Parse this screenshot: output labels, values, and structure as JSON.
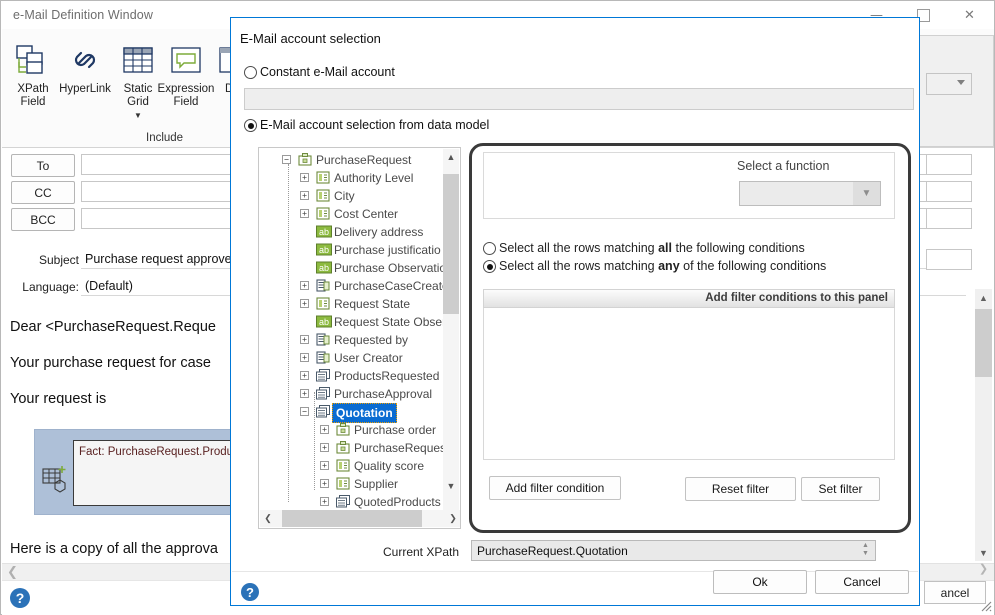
{
  "background_window": {
    "title": "e-Mail Definition Window",
    "window_buttons": {
      "minimize": "—",
      "maximize": "▢",
      "close": "✕"
    },
    "ribbon": {
      "group_label": "Include",
      "items": [
        {
          "label_line1": "XPath",
          "label_line2": "Field",
          "icon": "xpath-field-icon"
        },
        {
          "label_line1": "HyperLink",
          "label_line2": "",
          "icon": "hyperlink-icon"
        },
        {
          "label_line1": "Static",
          "label_line2": "Grid",
          "icon": "static-grid-icon"
        },
        {
          "label_line1": "Expression",
          "label_line2": "Field",
          "icon": "expression-field-icon"
        },
        {
          "label_line1": "Dy",
          "label_line2": "",
          "icon": "dynamic-field-icon"
        }
      ]
    },
    "recipients": [
      {
        "button": "To",
        "value": ""
      },
      {
        "button": "CC",
        "value": ""
      },
      {
        "button": "BCC",
        "value": ""
      }
    ],
    "subject_label": "Subject",
    "subject_value": "Purchase request approved",
    "language_label": "Language:",
    "language_value": "(Default)",
    "body_lines": [
      "Dear <PurchaseRequest.Reque",
      "Your purchase request for case",
      "Your request is"
    ],
    "grid_widget_text": "Fact: PurchaseRequest.Produc",
    "body_last_line": "Here is a copy of all the approva",
    "cancel_button": "ancel",
    "help_icon": "help-icon"
  },
  "dialog": {
    "title": "E-Mail account selection",
    "window_buttons": {
      "minimize": "—",
      "maximize": "▢",
      "close": "✕"
    },
    "option_constant": {
      "label": "Constant e-Mail account",
      "selected": false
    },
    "constant_input_value": "",
    "option_datamodel": {
      "label": "E-Mail account selection from data model",
      "selected": true
    },
    "tree": {
      "nodes": [
        {
          "label": "PurchaseRequest",
          "depth": 0,
          "expander": "-",
          "icon": "entity-icon",
          "selected": false
        },
        {
          "label": "Authority Level",
          "depth": 1,
          "expander": "+",
          "icon": "enum-icon",
          "selected": false
        },
        {
          "label": "City",
          "depth": 1,
          "expander": "+",
          "icon": "enum-icon",
          "selected": false
        },
        {
          "label": "Cost Center",
          "depth": 1,
          "expander": "+",
          "icon": "enum-icon",
          "selected": false
        },
        {
          "label": "Delivery address",
          "depth": 1,
          "expander": "",
          "icon": "text-icon",
          "selected": false
        },
        {
          "label": "Purchase justificatio",
          "depth": 1,
          "expander": "",
          "icon": "text-icon",
          "selected": false
        },
        {
          "label": "Purchase Observatio",
          "depth": 1,
          "expander": "",
          "icon": "text-icon",
          "selected": false
        },
        {
          "label": "PurchaseCaseCreato",
          "depth": 1,
          "expander": "+",
          "icon": "record-icon",
          "selected": false
        },
        {
          "label": "Request State",
          "depth": 1,
          "expander": "+",
          "icon": "enum-icon",
          "selected": false
        },
        {
          "label": "Request State Obser",
          "depth": 1,
          "expander": "",
          "icon": "text-icon",
          "selected": false
        },
        {
          "label": "Requested by",
          "depth": 1,
          "expander": "+",
          "icon": "record-icon",
          "selected": false
        },
        {
          "label": "User Creator",
          "depth": 1,
          "expander": "+",
          "icon": "record-icon",
          "selected": false
        },
        {
          "label": "ProductsRequested",
          "depth": 1,
          "expander": "+",
          "icon": "collection-icon",
          "selected": false
        },
        {
          "label": "PurchaseApproval",
          "depth": 1,
          "expander": "+",
          "icon": "collection-icon",
          "selected": false
        },
        {
          "label": "Quotation",
          "depth": 1,
          "expander": "-",
          "icon": "collection-icon",
          "selected": true
        },
        {
          "label": "Purchase order",
          "depth": 2,
          "expander": "+",
          "icon": "entity-icon",
          "selected": false
        },
        {
          "label": "PurchaseRequest",
          "depth": 2,
          "expander": "+",
          "icon": "entity-icon",
          "selected": false
        },
        {
          "label": "Quality score",
          "depth": 2,
          "expander": "+",
          "icon": "enum-icon",
          "selected": false
        },
        {
          "label": "Supplier",
          "depth": 2,
          "expander": "+",
          "icon": "enum-icon",
          "selected": false
        },
        {
          "label": "QuotedProducts",
          "depth": 2,
          "expander": "+",
          "icon": "collection-icon",
          "selected": false
        }
      ]
    },
    "function_panel": {
      "label": "Select a function",
      "selected_value": "",
      "dropdown_icon": "chevron-down-icon"
    },
    "match_options": [
      {
        "label_pre": "Select all the rows matching ",
        "label_bold": "all",
        "label_post": " the following conditions",
        "selected": false
      },
      {
        "label_pre": "Select all the rows matching ",
        "label_bold": "any",
        "label_post": " of the following conditions",
        "selected": true
      }
    ],
    "filter_header": "Add filter conditions to this panel",
    "filter_rows": [],
    "filter_buttons": {
      "add": "Add filter condition",
      "reset": "Reset  filter",
      "set": "Set  filter"
    },
    "xpath_label": "Current XPath",
    "xpath_value": "PurchaseRequest.Quotation",
    "ok_button": "Ok",
    "cancel_button": "Cancel",
    "help_icon": "help-icon"
  }
}
